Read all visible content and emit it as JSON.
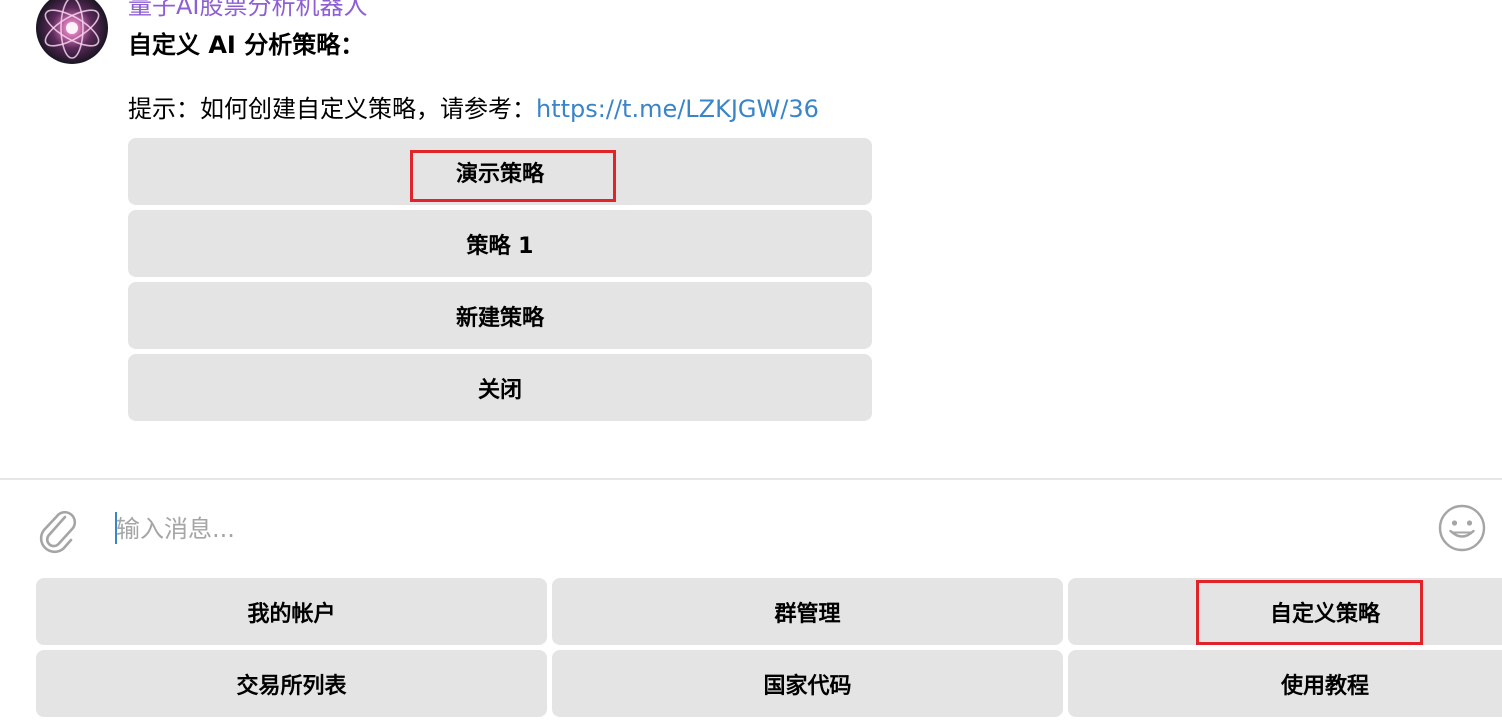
{
  "message": {
    "sender_name": "量子AI股票分析机器人",
    "title": "自定义 AI 分析策略：",
    "hint_prefix": "提示：如何创建自定义策略，请参考：",
    "hint_link": "https://t.me/LZKJGW/36"
  },
  "inline_keyboard": {
    "buttons": [
      "演示策略",
      "策略 1",
      "新建策略",
      "关闭"
    ]
  },
  "composer": {
    "placeholder": "输入消息..."
  },
  "reply_keyboard": {
    "rows": [
      [
        "我的帐户",
        "群管理",
        "自定义策略"
      ],
      [
        "交易所列表",
        "国家代码",
        "使用教程"
      ]
    ]
  },
  "colors": {
    "sender": "#8e5fd2",
    "link": "#3a85c8",
    "button_bg": "#e4e4e4",
    "highlight": "#e0242a"
  },
  "icons": {
    "attach": "paperclip-icon",
    "emoji": "smiley-icon"
  }
}
